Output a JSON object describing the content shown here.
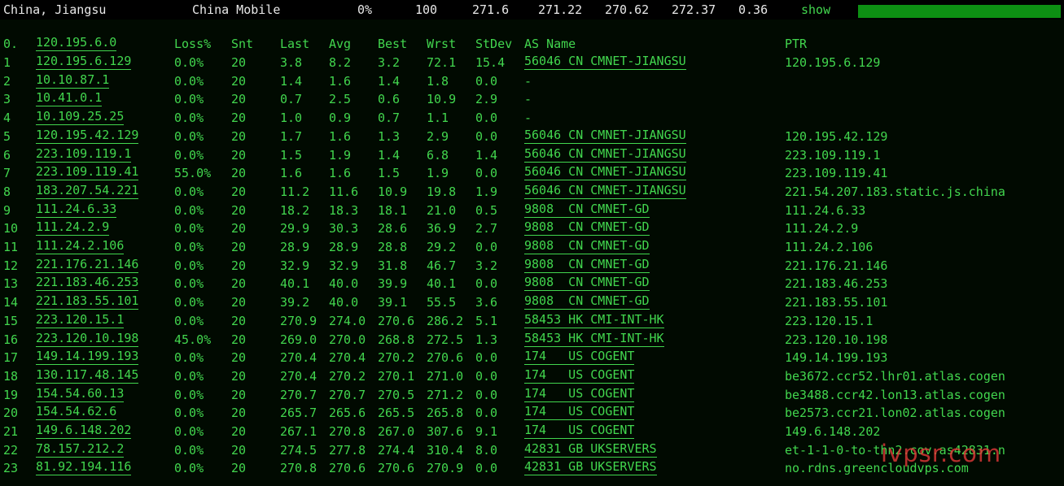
{
  "top": {
    "location": "China, Jiangsu",
    "isp": "China Mobile",
    "loss": "0%",
    "sent": "100",
    "last": "271.6",
    "avg": "271.22",
    "best": "270.62",
    "worst": "272.37",
    "stdev": "0.36",
    "show_label": "show",
    "bar_fill_fraction": 1.0,
    "bar_color": "#0d8f13"
  },
  "header": {
    "hop": "0.",
    "host": "120.195.6.0",
    "loss": "Loss%",
    "snt": "Snt",
    "last": "Last",
    "avg": "Avg",
    "best": "Best",
    "wrst": "Wrst",
    "stdev": "StDev",
    "as_name": "AS Name",
    "ptr": "PTR"
  },
  "hops": [
    {
      "n": "1",
      "ip": "120.195.6.129",
      "loss": "0.0%",
      "snt": "20",
      "last": "3.8",
      "avg": "8.2",
      "best": "3.2",
      "wrst": "72.1",
      "stdev": "15.4",
      "asn": "56046 CN CMNET-JIANGSU",
      "ptr": "120.195.6.129"
    },
    {
      "n": "2",
      "ip": "10.10.87.1",
      "loss": "0.0%",
      "snt": "20",
      "last": "1.4",
      "avg": "1.6",
      "best": "1.4",
      "wrst": "1.8",
      "stdev": "0.0",
      "asn": "-",
      "ptr": ""
    },
    {
      "n": "3",
      "ip": "10.41.0.1",
      "loss": "0.0%",
      "snt": "20",
      "last": "0.7",
      "avg": "2.5",
      "best": "0.6",
      "wrst": "10.9",
      "stdev": "2.9",
      "asn": "-",
      "ptr": ""
    },
    {
      "n": "4",
      "ip": "10.109.25.25",
      "loss": "0.0%",
      "snt": "20",
      "last": "1.0",
      "avg": "0.9",
      "best": "0.7",
      "wrst": "1.1",
      "stdev": "0.0",
      "asn": "-",
      "ptr": ""
    },
    {
      "n": "5",
      "ip": "120.195.42.129",
      "loss": "0.0%",
      "snt": "20",
      "last": "1.7",
      "avg": "1.6",
      "best": "1.3",
      "wrst": "2.9",
      "stdev": "0.0",
      "asn": "56046 CN CMNET-JIANGSU",
      "ptr": "120.195.42.129"
    },
    {
      "n": "6",
      "ip": "223.109.119.1",
      "loss": "0.0%",
      "snt": "20",
      "last": "1.5",
      "avg": "1.9",
      "best": "1.4",
      "wrst": "6.8",
      "stdev": "1.4",
      "asn": "56046 CN CMNET-JIANGSU",
      "ptr": "223.109.119.1"
    },
    {
      "n": "7",
      "ip": "223.109.119.41",
      "loss": "55.0%",
      "snt": "20",
      "last": "1.6",
      "avg": "1.6",
      "best": "1.5",
      "wrst": "1.9",
      "stdev": "0.0",
      "asn": "56046 CN CMNET-JIANGSU",
      "ptr": "223.109.119.41"
    },
    {
      "n": "8",
      "ip": "183.207.54.221",
      "loss": "0.0%",
      "snt": "20",
      "last": "11.2",
      "avg": "11.6",
      "best": "10.9",
      "wrst": "19.8",
      "stdev": "1.9",
      "asn": "56046 CN CMNET-JIANGSU",
      "ptr": "221.54.207.183.static.js.china"
    },
    {
      "n": "9",
      "ip": "111.24.6.33",
      "loss": "0.0%",
      "snt": "20",
      "last": "18.2",
      "avg": "18.3",
      "best": "18.1",
      "wrst": "21.0",
      "stdev": "0.5",
      "asn": "9808  CN CMNET-GD",
      "ptr": "111.24.6.33"
    },
    {
      "n": "10",
      "ip": "111.24.2.9",
      "loss": "0.0%",
      "snt": "20",
      "last": "29.9",
      "avg": "30.3",
      "best": "28.6",
      "wrst": "36.9",
      "stdev": "2.7",
      "asn": "9808  CN CMNET-GD",
      "ptr": "111.24.2.9"
    },
    {
      "n": "11",
      "ip": "111.24.2.106",
      "loss": "0.0%",
      "snt": "20",
      "last": "28.9",
      "avg": "28.9",
      "best": "28.8",
      "wrst": "29.2",
      "stdev": "0.0",
      "asn": "9808  CN CMNET-GD",
      "ptr": "111.24.2.106"
    },
    {
      "n": "12",
      "ip": "221.176.21.146",
      "loss": "0.0%",
      "snt": "20",
      "last": "32.9",
      "avg": "32.9",
      "best": "31.8",
      "wrst": "46.7",
      "stdev": "3.2",
      "asn": "9808  CN CMNET-GD",
      "ptr": "221.176.21.146"
    },
    {
      "n": "13",
      "ip": "221.183.46.253",
      "loss": "0.0%",
      "snt": "20",
      "last": "40.1",
      "avg": "40.0",
      "best": "39.9",
      "wrst": "40.1",
      "stdev": "0.0",
      "asn": "9808  CN CMNET-GD",
      "ptr": "221.183.46.253"
    },
    {
      "n": "14",
      "ip": "221.183.55.101",
      "loss": "0.0%",
      "snt": "20",
      "last": "39.2",
      "avg": "40.0",
      "best": "39.1",
      "wrst": "55.5",
      "stdev": "3.6",
      "asn": "9808  CN CMNET-GD",
      "ptr": "221.183.55.101"
    },
    {
      "n": "15",
      "ip": "223.120.15.1",
      "loss": "0.0%",
      "snt": "20",
      "last": "270.9",
      "avg": "274.0",
      "best": "270.6",
      "wrst": "286.2",
      "stdev": "5.1",
      "asn": "58453 HK CMI-INT-HK",
      "ptr": "223.120.15.1"
    },
    {
      "n": "16",
      "ip": "223.120.10.198",
      "loss": "45.0%",
      "snt": "20",
      "last": "269.0",
      "avg": "270.0",
      "best": "268.8",
      "wrst": "272.5",
      "stdev": "1.3",
      "asn": "58453 HK CMI-INT-HK",
      "ptr": "223.120.10.198"
    },
    {
      "n": "17",
      "ip": "149.14.199.193",
      "loss": "0.0%",
      "snt": "20",
      "last": "270.4",
      "avg": "270.4",
      "best": "270.2",
      "wrst": "270.6",
      "stdev": "0.0",
      "asn": "174   US COGENT",
      "ptr": "149.14.199.193"
    },
    {
      "n": "18",
      "ip": "130.117.48.145",
      "loss": "0.0%",
      "snt": "20",
      "last": "270.4",
      "avg": "270.2",
      "best": "270.1",
      "wrst": "271.0",
      "stdev": "0.0",
      "asn": "174   US COGENT",
      "ptr": "be3672.ccr52.lhr01.atlas.cogen"
    },
    {
      "n": "19",
      "ip": "154.54.60.13",
      "loss": "0.0%",
      "snt": "20",
      "last": "270.7",
      "avg": "270.7",
      "best": "270.5",
      "wrst": "271.2",
      "stdev": "0.0",
      "asn": "174   US COGENT",
      "ptr": "be3488.ccr42.lon13.atlas.cogen"
    },
    {
      "n": "20",
      "ip": "154.54.62.6",
      "loss": "0.0%",
      "snt": "20",
      "last": "265.7",
      "avg": "265.6",
      "best": "265.5",
      "wrst": "265.8",
      "stdev": "0.0",
      "asn": "174   US COGENT",
      "ptr": "be2573.ccr21.lon02.atlas.cogen"
    },
    {
      "n": "21",
      "ip": "149.6.148.202",
      "loss": "0.0%",
      "snt": "20",
      "last": "267.1",
      "avg": "270.8",
      "best": "267.0",
      "wrst": "307.6",
      "stdev": "9.1",
      "asn": "174   US COGENT",
      "ptr": "149.6.148.202"
    },
    {
      "n": "22",
      "ip": "78.157.212.2",
      "loss": "0.0%",
      "snt": "20",
      "last": "274.5",
      "avg": "277.8",
      "best": "274.4",
      "wrst": "310.4",
      "stdev": "8.0",
      "asn": "42831 GB UKSERVERS",
      "ptr": "et-1-1-0-to-thn2.cov.as42831.n"
    },
    {
      "n": "23",
      "ip": "81.92.194.116",
      "loss": "0.0%",
      "snt": "20",
      "last": "270.8",
      "avg": "270.6",
      "best": "270.6",
      "wrst": "270.9",
      "stdev": "0.0",
      "asn": "42831 GB UKSERVERS",
      "ptr": "no.rdns.greencloudvps.com"
    }
  ],
  "watermark": "ivpsr.com",
  "colors": {
    "text_green": "#42d64e",
    "header_text": "#e8e8e8",
    "background": "#010a01",
    "watermark_red": "#e83a3a"
  }
}
